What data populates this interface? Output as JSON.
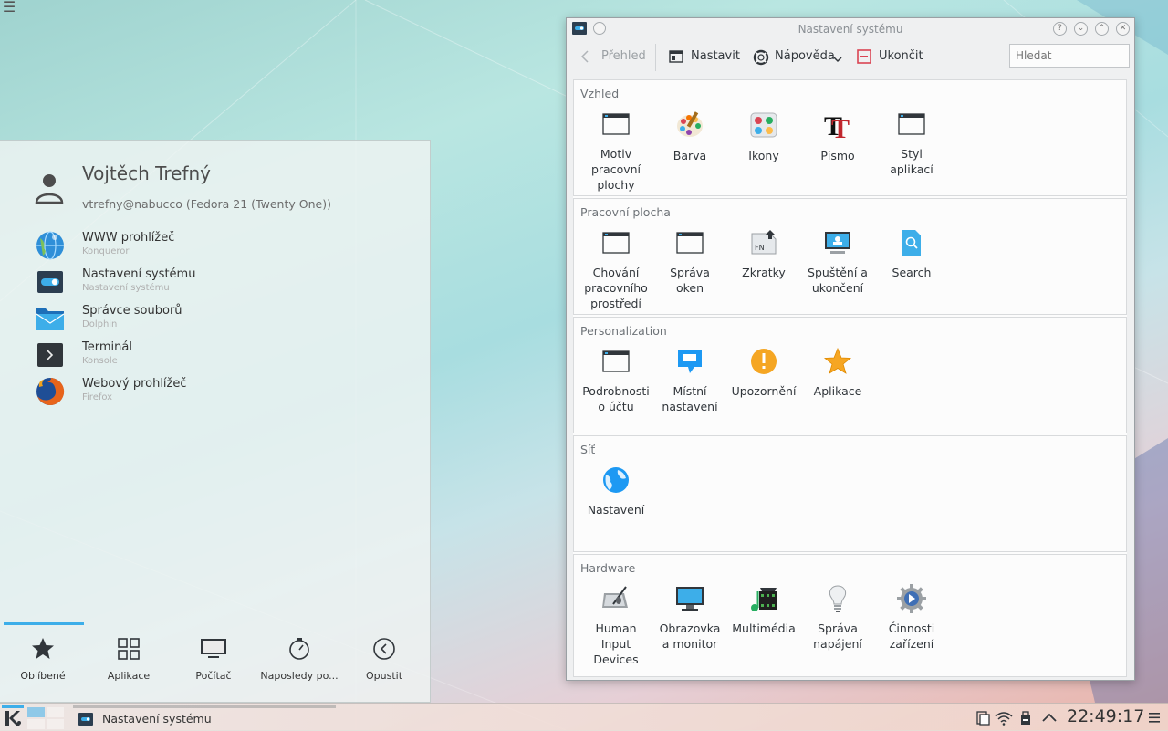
{
  "desktop": {
    "corner_menu_icon": "hamburger-icon"
  },
  "launcher": {
    "user": {
      "name": "Vojtěch Trefný",
      "host": "vtrefny@nabucco (Fedora 21 (Twenty One))"
    },
    "favorites": [
      {
        "title": "WWW prohlížeč",
        "subtitle": "Konqueror",
        "icon": "globe-icon"
      },
      {
        "title": "Nastavení systému",
        "subtitle": "Nastavení systému",
        "icon": "settings-toggle-icon"
      },
      {
        "title": "Správce souborů",
        "subtitle": "Dolphin",
        "icon": "folder-icon"
      },
      {
        "title": "Terminál",
        "subtitle": "Konsole",
        "icon": "terminal-icon"
      },
      {
        "title": "Webový prohlížeč",
        "subtitle": "Firefox",
        "icon": "firefox-icon"
      }
    ],
    "tabs": [
      {
        "label": "Oblíbené",
        "icon": "star-icon"
      },
      {
        "label": "Aplikace",
        "icon": "grid-icon"
      },
      {
        "label": "Počítač",
        "icon": "monitor-icon"
      },
      {
        "label": "Naposledy po...",
        "icon": "history-icon"
      },
      {
        "label": "Opustit",
        "icon": "back-circle-icon"
      }
    ],
    "accent": "#3daee9"
  },
  "window": {
    "title": "Nastavení systému",
    "toolbar": {
      "back": "Přehled",
      "configure": "Nastavit",
      "help": "Nápověda",
      "quit": "Ukončit",
      "search_placeholder": "Hledat"
    },
    "categories": [
      {
        "title": "Vzhled",
        "items": [
          "Motiv\npracovní\nplochy",
          "Barva",
          "Ikony",
          "Písmo",
          "Styl\naplikací"
        ]
      },
      {
        "title": "Pracovní plocha",
        "items": [
          "Chování\npracovního\nprostředí",
          "Správa\noken",
          "Zkratky",
          "Spuštění a\nukončení",
          "Search"
        ]
      },
      {
        "title": "Personalization",
        "items": [
          "Podrobnosti\no účtu",
          "Místní\nnastavení",
          "Upozornění",
          "Aplikace"
        ]
      },
      {
        "title": "Síť",
        "items": [
          "Nastavení"
        ]
      },
      {
        "title": "Hardware",
        "items": [
          "Human\nInput\nDevices",
          "Obrazovka\na monitor",
          "Multimédia",
          "Správa\nnapájení",
          "Činnosti\nzařízení"
        ]
      }
    ]
  },
  "taskbar": {
    "task_label": "Nastavení systému",
    "clock": "22:49:17"
  }
}
